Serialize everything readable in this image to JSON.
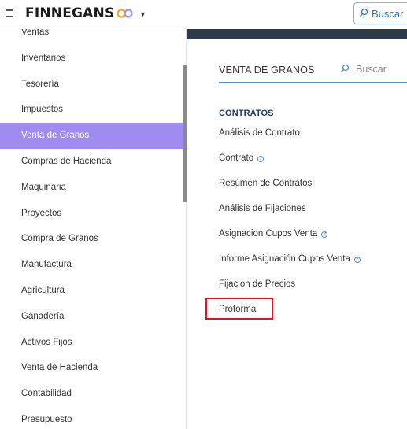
{
  "app": {
    "brand": "FINNEGANS",
    "top_search_label": "Buscar",
    "colors": {
      "active": "#a08cf0",
      "header_strip": "#2d3a4a",
      "highlight": "#e8101a",
      "link_accent": "#4a90d9"
    }
  },
  "sidebar": {
    "items": [
      {
        "label": "Ventas",
        "active": false
      },
      {
        "label": "Inventarios",
        "active": false
      },
      {
        "label": "Tesorería",
        "active": false
      },
      {
        "label": "Impuestos",
        "active": false
      },
      {
        "label": "Venta de Granos",
        "active": true
      },
      {
        "label": "Compras de Hacienda",
        "active": false
      },
      {
        "label": "Maquinaria",
        "active": false
      },
      {
        "label": "Proyectos",
        "active": false
      },
      {
        "label": "Compra de Granos",
        "active": false
      },
      {
        "label": "Manufactura",
        "active": false
      },
      {
        "label": "Agricultura",
        "active": false
      },
      {
        "label": "Ganadería",
        "active": false
      },
      {
        "label": "Activos Fijos",
        "active": false
      },
      {
        "label": "Venta de Hacienda",
        "active": false
      },
      {
        "label": "Contabilidad",
        "active": false
      },
      {
        "label": "Presupuesto",
        "active": false
      }
    ]
  },
  "main": {
    "section_title": "VENTA DE GRANOS",
    "search_placeholder": "Buscar",
    "group_title": "CONTRATOS",
    "links": [
      {
        "label": "Análisis de Contrato",
        "help": false
      },
      {
        "label": "Contrato",
        "help": true
      },
      {
        "label": "Resúmen de Contratos",
        "help": false
      },
      {
        "label": "Análisis de Fijaciones",
        "help": false
      },
      {
        "label": "Asignacion Cupos Venta",
        "help": true
      },
      {
        "label": "Informe Asignación Cupos Venta",
        "help": true
      },
      {
        "label": "Fijacion de Precios",
        "help": false
      },
      {
        "label": "Proforma",
        "help": false
      }
    ],
    "help_glyph": "?"
  }
}
